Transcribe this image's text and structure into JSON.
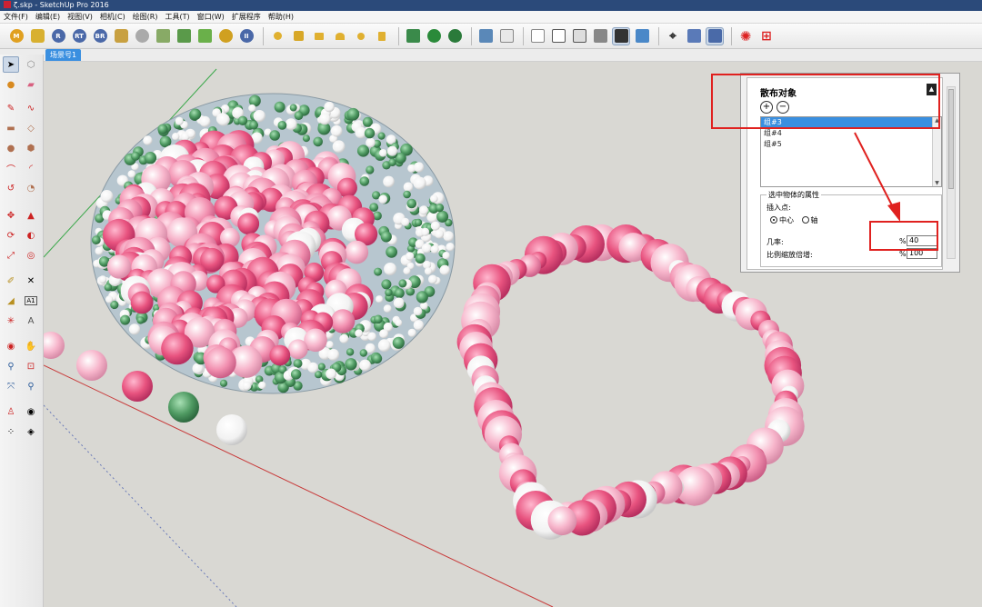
{
  "window": {
    "title": "ζ.skp - SketchUp Pro 2016"
  },
  "menu": [
    "文件(F)",
    "编辑(E)",
    "视图(V)",
    "相机(C)",
    "绘图(R)",
    "工具(T)",
    "窗口(W)",
    "扩展程序",
    "帮助(H)"
  ],
  "toolbar": {
    "plugin_letters": [
      "M",
      "",
      "R",
      "RT",
      "BR",
      "",
      "",
      "",
      "",
      "",
      "",
      "II"
    ]
  },
  "scene_tab": "场景号1",
  "panel": {
    "title": "散布对象",
    "list_items": [
      "组#3",
      "组#4",
      "组#5"
    ],
    "selected_index": 0,
    "props_title": "选中物体的属性",
    "insert_label": "插入点:",
    "radio_center": "中心",
    "radio_axis": "轴",
    "probability_label": "几率:",
    "probability_unit": "%",
    "probability_value": "40",
    "scale_label": "比例缩放倍增:",
    "scale_unit": "%",
    "scale_value": "100"
  },
  "colors": {
    "viewport_bg": "#d9d8d3",
    "selection_blue": "#3a8fe0",
    "highlight_red": "#e0211f",
    "sphere_pink": "#e8537f",
    "sphere_light_pink": "#f7b5cb",
    "sphere_green": "#4f9a62",
    "sphere_white": "#ffffff"
  }
}
